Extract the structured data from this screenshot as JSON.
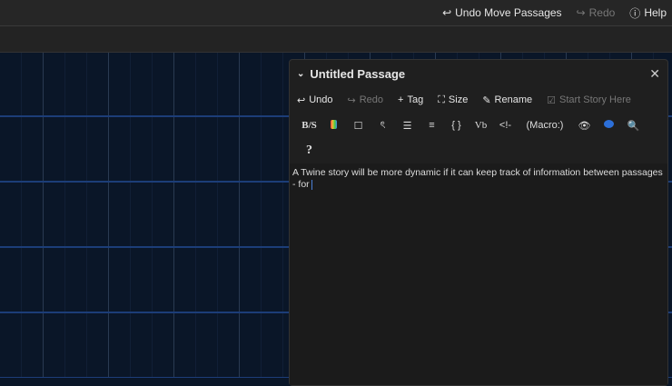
{
  "topbar": {
    "undo": "Undo Move Passages",
    "redo": "Redo",
    "help": "Help"
  },
  "dialog": {
    "title": "Untitled Passage",
    "toolbar": {
      "undo": "Undo",
      "redo": "Redo",
      "tag": "Tag",
      "size": "Size",
      "rename": "Rename",
      "start": "Start Story Here"
    },
    "format_toolbar": {
      "bold_strike": "B/S",
      "code": "{ }",
      "verbatim": "Vb",
      "comment": "<!-",
      "macro": "(Macro:)",
      "help": "?"
    },
    "text": "A Twine story will be more dynamic if it can keep track of information between passages - for"
  },
  "colors": {
    "canvas": "#0a1628",
    "grid_major": "#1c3d78",
    "accent": "#2c6fd8"
  }
}
